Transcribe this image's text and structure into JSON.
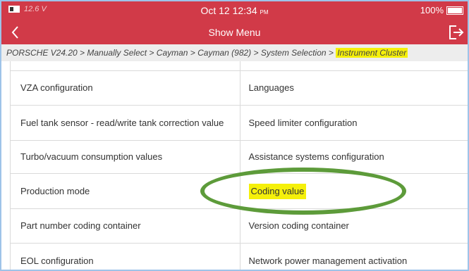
{
  "status_bar": {
    "voltage": "12.6 V",
    "time": "Oct 12  12:34",
    "ampm": "PM",
    "battery_percent": "100%"
  },
  "title_bar": {
    "title": "Show Menu",
    "back_icon": "chevron-left-icon",
    "exit_icon": "exit-icon"
  },
  "breadcrumb": {
    "path": "PORSCHE V24.20 > Manually Select > Cayman > Cayman (982) > System Selection > ",
    "current": "Instrument Cluster"
  },
  "menu": {
    "rows": [
      {
        "left": "VZA configuration",
        "right": "Languages"
      },
      {
        "left": "Fuel tank sensor - read/write tank correction value",
        "right": "Speed limiter configuration"
      },
      {
        "left": "Turbo/vacuum consumption values",
        "right": "Assistance systems configuration"
      },
      {
        "left": "Production mode",
        "right": "Coding value"
      },
      {
        "left": "Part number coding container",
        "right": "Version coding container"
      },
      {
        "left": "EOL configuration",
        "right": "Network power management activation"
      }
    ]
  },
  "colors": {
    "header_red": "#d13a48",
    "highlight_yellow": "#f5f00a",
    "annotation_green": "#5d9b3a"
  }
}
